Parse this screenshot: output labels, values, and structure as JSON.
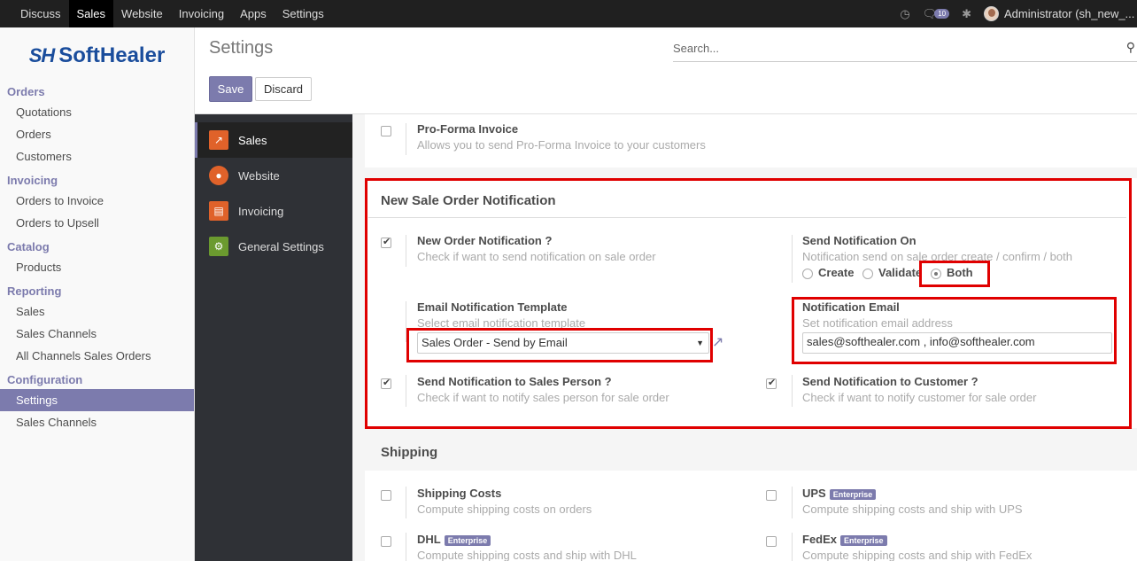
{
  "topnav": {
    "items": [
      "Discuss",
      "Sales",
      "Website",
      "Invoicing",
      "Apps",
      "Settings"
    ],
    "active_index": 1,
    "chat_count": "10",
    "user": "Administrator (sh_new_..."
  },
  "brand": {
    "mark": "SH",
    "name": "SoftHealer"
  },
  "sidebar": {
    "sections": [
      {
        "title": "Orders",
        "items": [
          "Quotations",
          "Orders",
          "Customers"
        ]
      },
      {
        "title": "Invoicing",
        "items": [
          "Orders to Invoice",
          "Orders to Upsell"
        ]
      },
      {
        "title": "Catalog",
        "items": [
          "Products"
        ]
      },
      {
        "title": "Reporting",
        "items": [
          "Sales",
          "Sales Channels",
          "All Channels Sales Orders"
        ]
      },
      {
        "title": "Configuration",
        "items": [
          "Settings",
          "Sales Channels"
        ]
      }
    ],
    "active_item": "Settings"
  },
  "control_panel": {
    "title": "Settings",
    "search_placeholder": "Search...",
    "save_label": "Save",
    "discard_label": "Discard"
  },
  "apps": [
    {
      "label": "Sales",
      "icon": "sales-chart-icon",
      "color": "#e0622a"
    },
    {
      "label": "Website",
      "icon": "globe-icon",
      "color": "#e0622a"
    },
    {
      "label": "Invoicing",
      "icon": "invoice-icon",
      "color": "#e0622a"
    },
    {
      "label": "General Settings",
      "icon": "gear-icon",
      "color": "#6b9a2f"
    }
  ],
  "content": {
    "proforma": {
      "label": "Pro-Forma Invoice",
      "desc": "Allows you to send Pro-Forma Invoice to your customers",
      "checked": false
    },
    "notification": {
      "heading": "New Sale Order Notification",
      "new_order": {
        "label": "New Order Notification ?",
        "desc": "Check if want to send notification on sale order",
        "checked": true
      },
      "send_on": {
        "label": "Send Notification On",
        "desc": "Notification send on sale order create / confirm / both",
        "options": [
          "Create",
          "Validate",
          "Both"
        ],
        "selected": "Both"
      },
      "template": {
        "label": "Email Notification Template",
        "desc": "Select email notification template",
        "value": "Sales Order - Send by Email"
      },
      "email": {
        "label": "Notification Email",
        "desc": "Set notification email address",
        "value": "sales@softhealer.com , info@softhealer.com"
      },
      "salesperson": {
        "label": "Send Notification to Sales Person ?",
        "desc": "Check if want to notify sales person for sale order",
        "checked": true
      },
      "customer": {
        "label": "Send Notification to Customer ?",
        "desc": "Check if want to notify customer for sale order",
        "checked": true
      }
    },
    "shipping": {
      "heading": "Shipping",
      "costs": {
        "label": "Shipping Costs",
        "desc": "Compute shipping costs on orders"
      },
      "ups": {
        "label": "UPS",
        "badge": "Enterprise",
        "desc": "Compute shipping costs and ship with UPS"
      },
      "dhl": {
        "label": "DHL",
        "badge": "Enterprise",
        "desc": "Compute shipping costs and ship with DHL"
      },
      "fedex": {
        "label": "FedEx",
        "badge": "Enterprise",
        "desc": "Compute shipping costs and ship with FedEx"
      }
    }
  },
  "colors": {
    "accent": "#7c7bad",
    "highlight": "#e00000",
    "topbar": "#202020",
    "apps_bg": "#2f3136"
  }
}
